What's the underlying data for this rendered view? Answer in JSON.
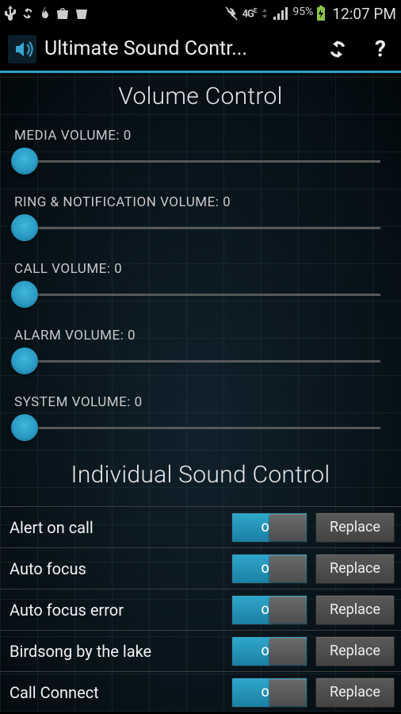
{
  "status": {
    "battery_pct": "95%",
    "time": "12:07 PM"
  },
  "appbar": {
    "title": "Ultimate Sound Contr..."
  },
  "sections": {
    "volume_title": "Volume Control",
    "sound_title": "Individual Sound Control"
  },
  "sliders": [
    {
      "label": "MEDIA VOLUME: 0",
      "value": 0
    },
    {
      "label": "RING & NOTIFICATION VOLUME: 0",
      "value": 0
    },
    {
      "label": "CALL VOLUME: 0",
      "value": 0
    },
    {
      "label": "ALARM VOLUME: 0",
      "value": 0
    },
    {
      "label": "SYSTEM VOLUME: 0",
      "value": 0
    }
  ],
  "toggle_label": "ON",
  "replace_label": "Replace",
  "sounds": [
    {
      "name": "Alert on call",
      "on": true
    },
    {
      "name": "Auto focus",
      "on": true
    },
    {
      "name": "Auto focus error",
      "on": true
    },
    {
      "name": "Birdsong by the lake",
      "on": true
    },
    {
      "name": "Call Connect",
      "on": true
    }
  ]
}
